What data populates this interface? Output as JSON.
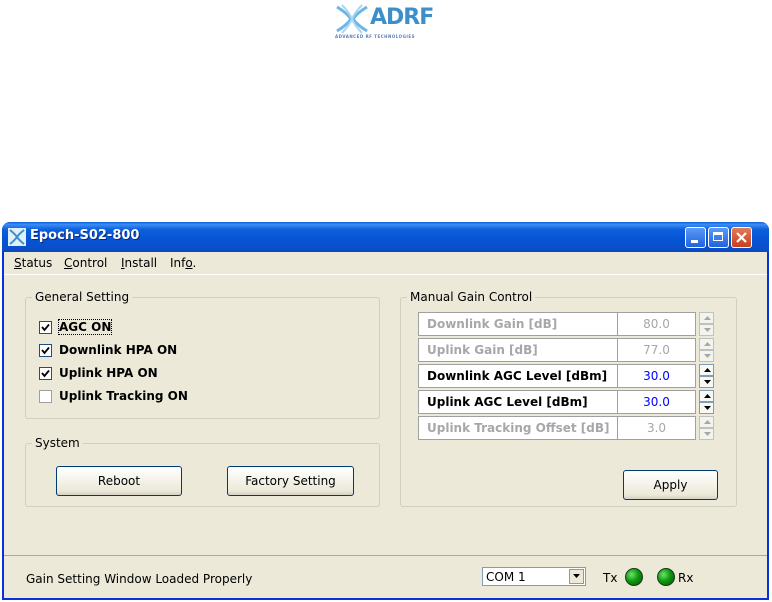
{
  "logo": {
    "brand": "ADRF",
    "tagline": "ADVANCED RF TECHNOLOGIES",
    "color": "#3c8fc9"
  },
  "window": {
    "title": "Epoch-S02-800",
    "icon": "epoch-app-icon"
  },
  "menu": [
    {
      "mnemonic": "S",
      "rest": "tatus"
    },
    {
      "mnemonic": "C",
      "rest": "ontrol"
    },
    {
      "mnemonic": "I",
      "rest": "nstall"
    },
    {
      "pre": "Inf",
      "mnemonic": "o",
      "rest": "."
    }
  ],
  "general_setting": {
    "title": "General Setting",
    "options": [
      {
        "label": "AGC ON",
        "checked": true
      },
      {
        "label": "Downlink HPA ON",
        "checked": true
      },
      {
        "label": "Uplink HPA ON",
        "checked": true
      },
      {
        "label": "Uplink Tracking ON",
        "checked": false
      }
    ]
  },
  "system": {
    "title": "System",
    "reboot_label": "Reboot",
    "factory_label": "Factory Setting"
  },
  "manual_gain": {
    "title": "Manual Gain Control",
    "rows": [
      {
        "name": "Downlink Gain [dB]",
        "value": "80.0",
        "enabled": false
      },
      {
        "name": "Uplink Gain [dB]",
        "value": "77.0",
        "enabled": false
      },
      {
        "name": "Downlink AGC Level [dBm]",
        "value": "30.0",
        "enabled": true
      },
      {
        "name": "Uplink AGC Level [dBm]",
        "value": "30.0",
        "enabled": true
      },
      {
        "name": "Uplink Tracking Offset [dB]",
        "value": "3.0",
        "enabled": false
      }
    ],
    "apply_label": "Apply"
  },
  "statusbar": {
    "message": "Gain Setting Window Loaded Properly",
    "port": "COM 1",
    "tx_label": "Tx",
    "rx_label": "Rx",
    "led_color": "#0f9a0f"
  }
}
